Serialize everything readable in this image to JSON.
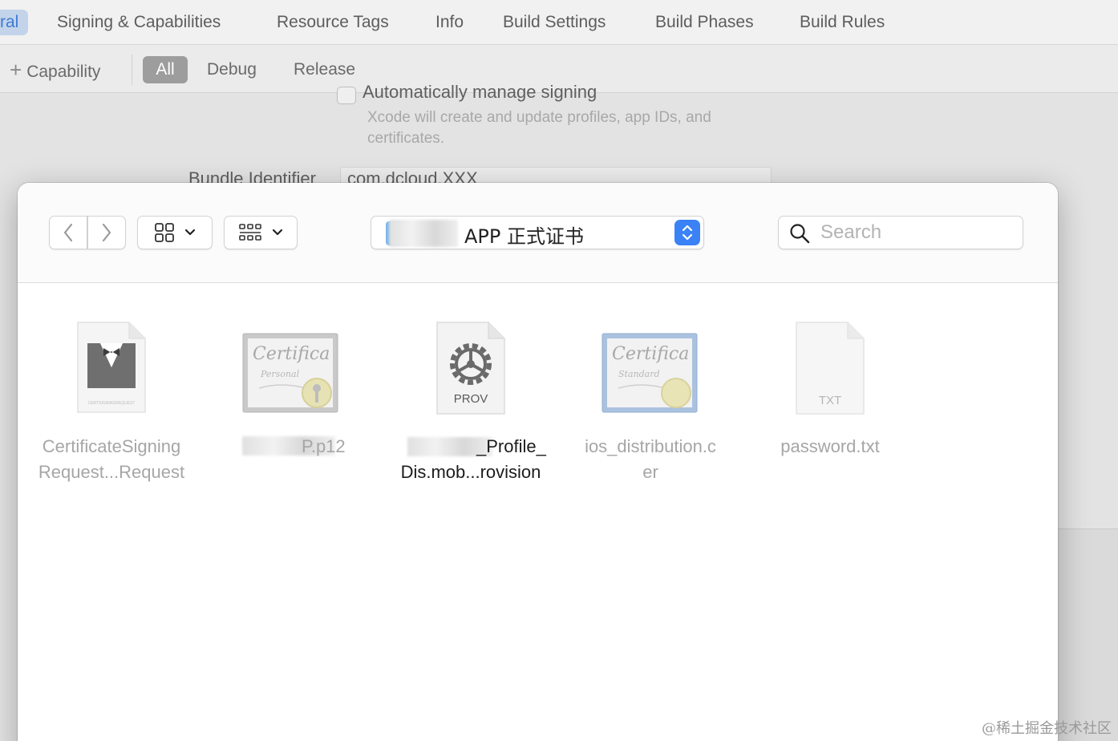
{
  "xcode": {
    "tabs": [
      {
        "label": "ral",
        "active": true
      },
      {
        "label": "Signing & Capabilities"
      },
      {
        "label": "Resource Tags"
      },
      {
        "label": "Info"
      },
      {
        "label": "Build Settings"
      },
      {
        "label": "Build Phases"
      },
      {
        "label": "Build Rules"
      }
    ],
    "capability_label": "Capability",
    "segments": [
      "All",
      "Debug",
      "Release"
    ],
    "auto_signing_label": "Automatically manage signing",
    "auto_signing_desc": "Xcode will create and update profiles, app IDs, and certificates.",
    "bundle_label": "Bundle Identifier",
    "bundle_value": "com.dcloud.XXX"
  },
  "dialog": {
    "folder_name": "APP 正式证书",
    "search_placeholder": "Search",
    "files": [
      {
        "line1": "CertificateSigning",
        "line2": "Request...Request",
        "icon": "certificate-request-icon",
        "badge": "CERTSIGNINGREQUEST",
        "selected": false
      },
      {
        "line1": "P.p12",
        "line2": "",
        "icon": "personal-certificate-icon",
        "badge": "",
        "selected": false
      },
      {
        "line1": "_Profile_",
        "line2": "Dis.mob...rovision",
        "icon": "provisioning-profile-icon",
        "badge": "PROV",
        "selected": true
      },
      {
        "line1": "ios_distribution.c",
        "line2": "er",
        "icon": "standard-certificate-icon",
        "badge": "",
        "selected": false
      },
      {
        "line1": "password.txt",
        "line2": "",
        "icon": "text-file-icon",
        "badge": "TXT",
        "selected": false
      }
    ]
  },
  "watermark": "@稀土掘金技术社区"
}
